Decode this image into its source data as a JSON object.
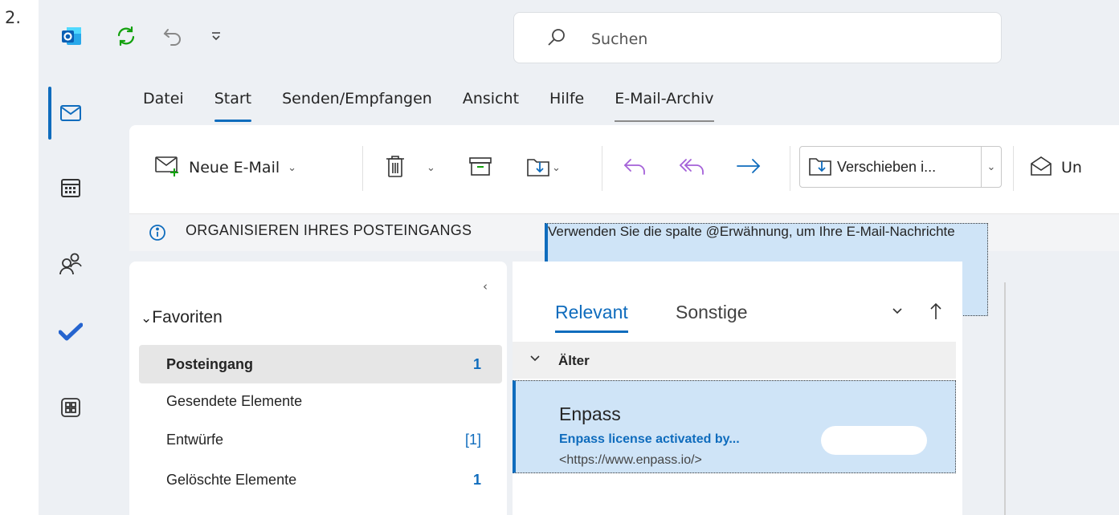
{
  "step_number": "2.",
  "search": {
    "placeholder": "Suchen"
  },
  "ribbon_tabs": [
    "Datei",
    "Start",
    "Senden/Empfangen",
    "Ansicht",
    "Hilfe",
    "E-Mail-Archiv"
  ],
  "active_tab": "Start",
  "ribbon": {
    "new_mail_label": "Neue E-Mail",
    "move_label": "Verschieben i...",
    "unread_label": "Un"
  },
  "infobar": {
    "title": "ORGANISIEREN IHRES POSTEINGANGS",
    "message": "Verwenden Sie die spalte @Erwähnung, um Ihre E-Mail-Nachrichte"
  },
  "folders": {
    "section_label": "Favoriten",
    "items": [
      {
        "label": "Posteingang",
        "count": "1"
      },
      {
        "label": "Gesendete Elemente",
        "count": ""
      },
      {
        "label": "Entwürfe",
        "count": "[1]"
      },
      {
        "label": "Gelöschte Elemente",
        "count": "1"
      }
    ]
  },
  "message_list": {
    "tabs": [
      "Relevant",
      "Sonstige"
    ],
    "group_label": "Älter",
    "messages": [
      {
        "sender": "Enpass",
        "subject": "Enpass license activated by...",
        "preview": "<https://www.enpass.io/>"
      }
    ]
  },
  "colors": {
    "accent": "#0f6cbd",
    "selected_message": "#cfe4f7",
    "app_background": "#edf0f4"
  }
}
